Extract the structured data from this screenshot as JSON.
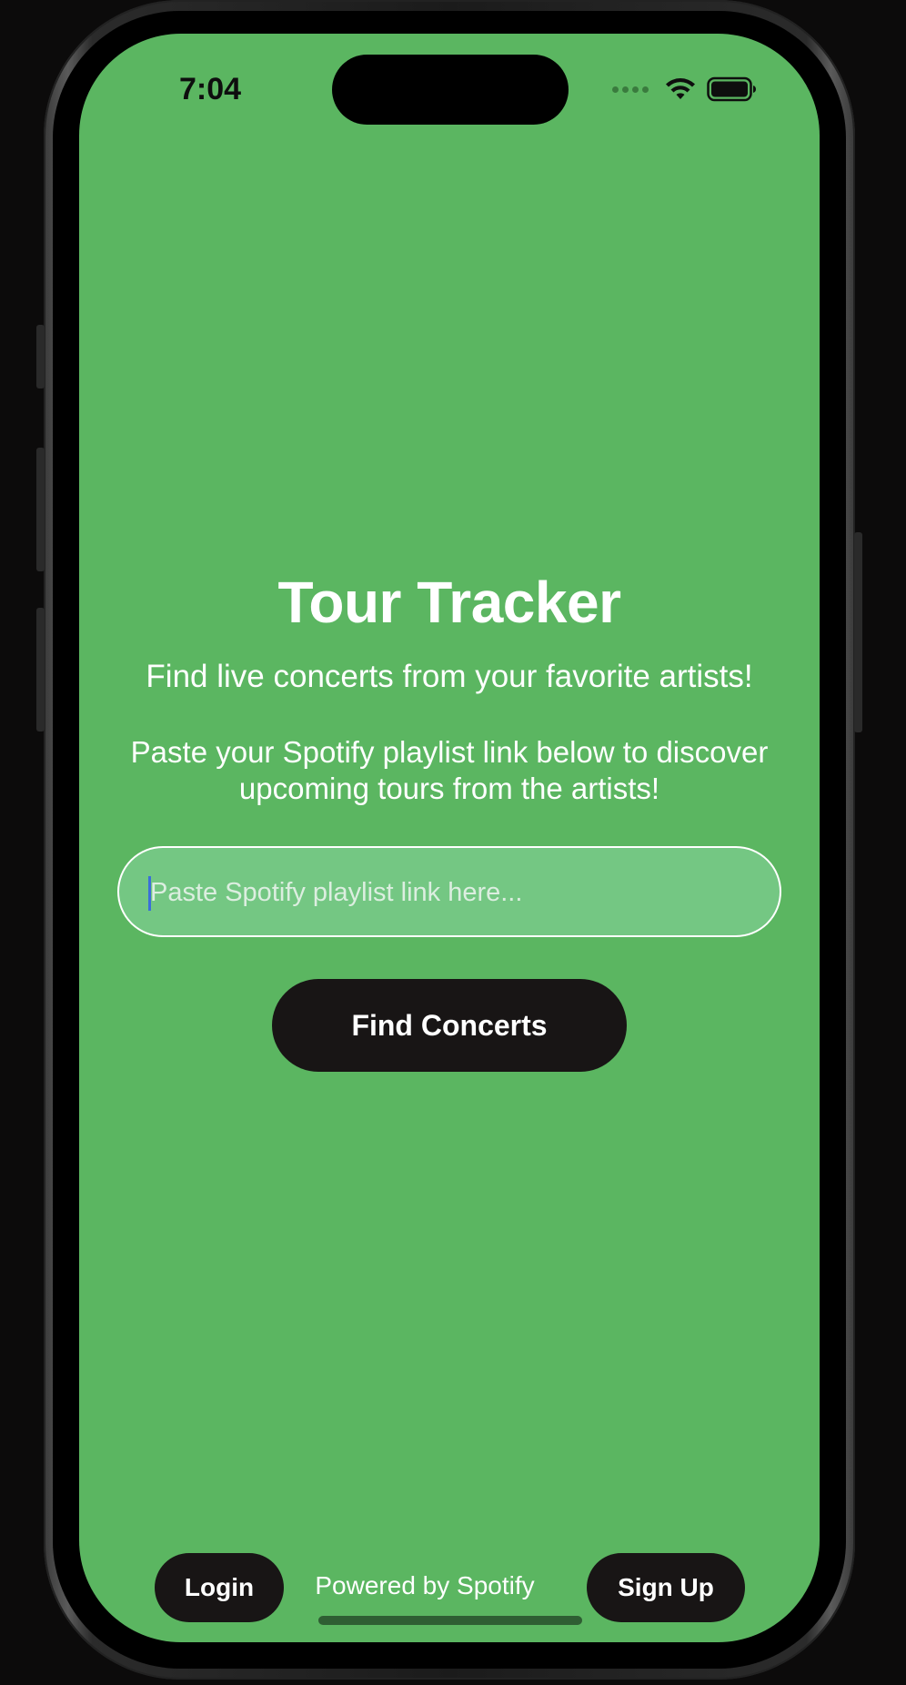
{
  "status_bar": {
    "time": "7:04",
    "signal_icon": "cellular-signal-dots",
    "wifi_icon": "wifi-icon",
    "battery_icon": "battery-full-icon"
  },
  "main": {
    "title": "Tour Tracker",
    "subtitle": "Find live concerts from your favorite artists!",
    "instructions": "Paste your Spotify playlist link below to discover upcoming tours from the artists!",
    "playlist_input": {
      "value": "",
      "placeholder": "Paste Spotify playlist link here..."
    },
    "find_button_label": "Find Concerts"
  },
  "footer": {
    "login_label": "Login",
    "powered_by": "Powered by Spotify",
    "signup_label": "Sign Up"
  },
  "colors": {
    "background": "#5bb661",
    "button": "#181515",
    "text": "#ffffff"
  }
}
